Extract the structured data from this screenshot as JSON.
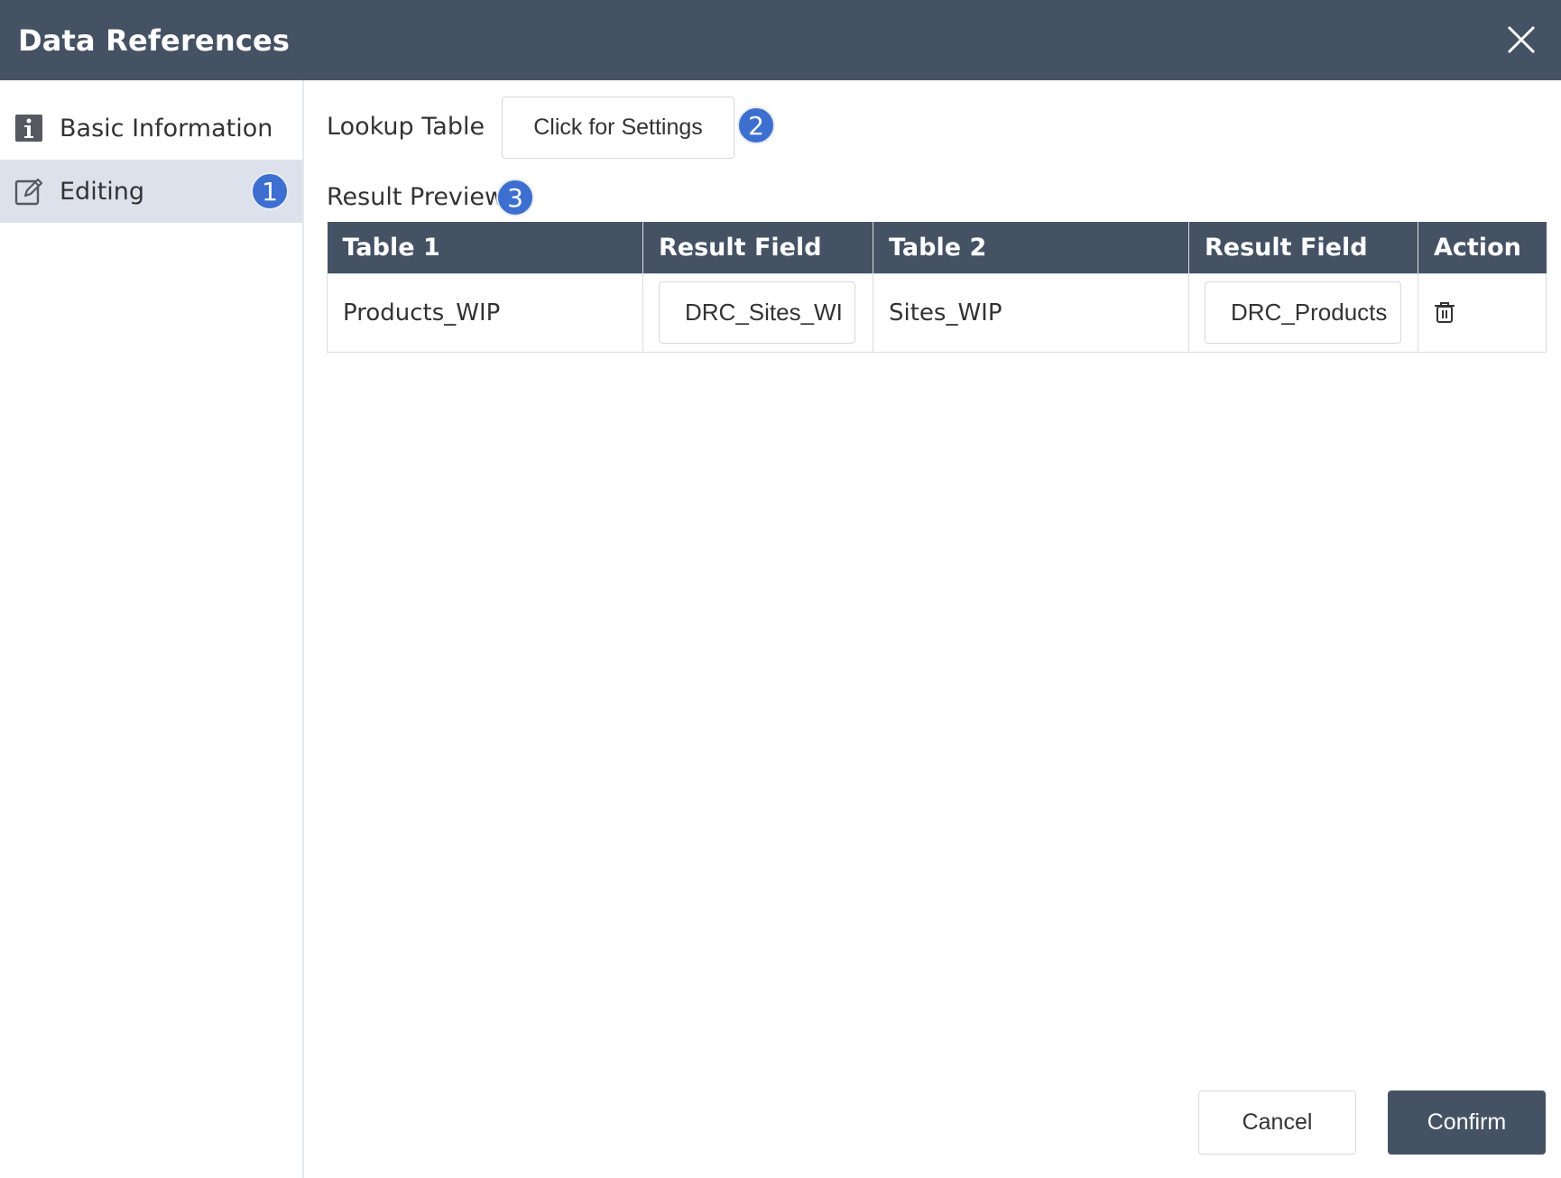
{
  "dialog": {
    "title": "Data References",
    "close_icon": "close-icon"
  },
  "sidebar": {
    "items": [
      {
        "label": "Basic Information",
        "icon": "info-icon",
        "selected": false
      },
      {
        "label": "Editing",
        "icon": "edit-icon",
        "selected": true,
        "badge": "1"
      }
    ]
  },
  "main": {
    "lookup_label": "Lookup Table",
    "settings_button": "Click for Settings",
    "settings_badge": "2",
    "preview_label": "Result Preview",
    "preview_badge": "3",
    "table": {
      "headers": [
        "Table 1",
        "Result Field",
        "Table 2",
        "Result Field",
        "Action"
      ],
      "rows": [
        {
          "table1": "Products_WIP",
          "result_field_1": "DRC_Sites_WI",
          "table2": "Sites_WIP",
          "result_field_2": "DRC_Products",
          "action_icon": "trash-icon"
        }
      ]
    }
  },
  "footer": {
    "cancel": "Cancel",
    "confirm": "Confirm"
  },
  "colors": {
    "header_bg": "#455264",
    "badge": "#3c6fd0",
    "selected_item_bg": "#dde1eb"
  }
}
